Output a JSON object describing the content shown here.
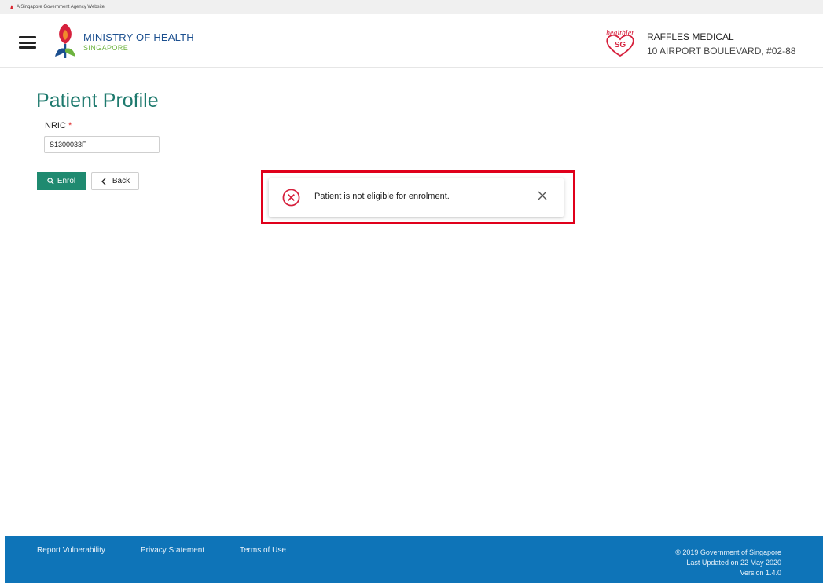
{
  "masthead": {
    "text": "A Singapore Government Agency Website"
  },
  "header": {
    "ministry_title": "MINISTRY OF HEALTH",
    "ministry_subtitle": "SINGAPORE",
    "hsg_logo_text": [
      "healthier",
      "SG"
    ],
    "clinic_name": "RAFFLES MEDICAL",
    "clinic_address": "10 AIRPORT BOULEVARD, #02-88"
  },
  "main": {
    "title": "Patient Profile",
    "nric_label": "NRIC",
    "nric_required_mark": "*",
    "nric_value": "S1300033F",
    "enrol_label": "Enrol",
    "back_label": "Back"
  },
  "toast": {
    "message": "Patient is not eligible for enrolment.",
    "type": "error"
  },
  "footer": {
    "links": [
      "Report Vulnerability",
      "Privacy Statement",
      "Terms of Use"
    ],
    "copyright": "© 2019 Government of Singapore",
    "last_updated": "Last Updated on 22 May 2020",
    "version": "Version 1.4.0"
  },
  "colors": {
    "accent_green": "#1f8a70",
    "title_teal": "#1e7a6e",
    "footer_blue": "#0e74b8",
    "error_red": "#d6203c",
    "highlight_red": "#e0001b"
  },
  "icons": [
    "lion-head-icon",
    "hamburger-menu-icon",
    "moh-logo-icon",
    "healthier-sg-logo-icon",
    "search-icon",
    "chevron-left-icon",
    "error-circle-icon",
    "close-icon"
  ]
}
